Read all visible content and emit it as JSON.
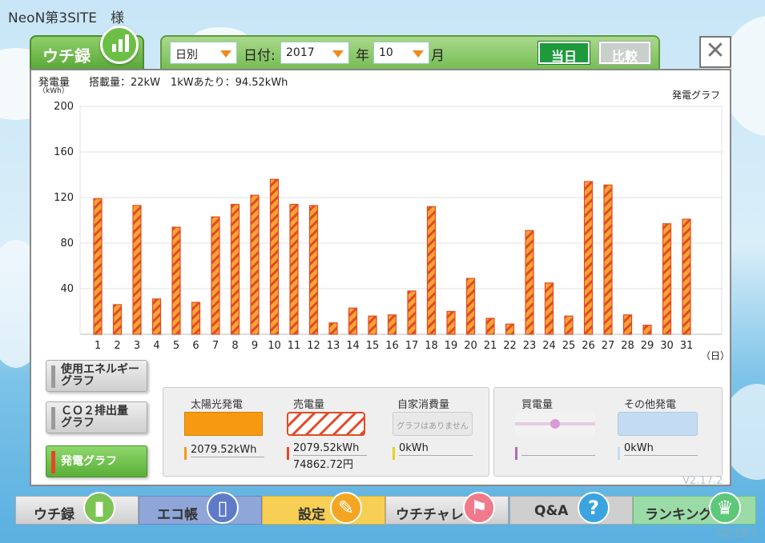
{
  "site": {
    "title": "NeoN第3SITE　様"
  },
  "tab": {
    "label": "ウチ録",
    "icon": "bar-chart-icon"
  },
  "topbar": {
    "mode": "日別",
    "date_label": "日付:",
    "year": "2017",
    "year_unit": "年",
    "month": "10",
    "month_unit": "月",
    "today_label": "当日",
    "compare_label": "比較"
  },
  "panel": {
    "title": "発電量",
    "unit": "（kWh）",
    "capacity": "搭載量：22kW　1kWあたり：94.52kWh",
    "graph_name": "発電グラフ",
    "x_unit": "（日）"
  },
  "chart_data": {
    "type": "bar",
    "categories": [
      "1",
      "2",
      "3",
      "4",
      "5",
      "6",
      "7",
      "8",
      "9",
      "10",
      "11",
      "12",
      "13",
      "14",
      "15",
      "16",
      "17",
      "18",
      "19",
      "20",
      "21",
      "22",
      "23",
      "24",
      "25",
      "26",
      "27",
      "28",
      "29",
      "30",
      "31"
    ],
    "values": [
      119,
      26,
      113,
      31,
      94,
      28,
      103,
      114,
      122,
      136,
      114,
      113,
      10,
      23,
      16,
      17,
      38,
      112,
      20,
      49,
      14,
      9,
      91,
      45,
      16,
      134,
      131,
      17,
      8,
      97,
      101
    ],
    "ylim": [
      0,
      200
    ],
    "yticks": [
      "40",
      "80",
      "120",
      "160",
      "200"
    ],
    "ytick_values": [
      40,
      80,
      120,
      160,
      200
    ],
    "colors": {
      "fill": "#f7a534",
      "stripe": "#e24a26"
    }
  },
  "sidebar": {
    "energy": "使用エネルギー\nグラフ",
    "co2": "ＣＯ２排出量\nグラフ",
    "power": "発電グラフ"
  },
  "legend": {
    "solar": {
      "title": "太陽光発電",
      "value": "2079.52kWh"
    },
    "sell": {
      "title": "売電量",
      "value": "2079.52kWh",
      "yen": "74862.72円"
    },
    "self": {
      "title": "自家消費量",
      "note": "グラフはありません",
      "value": "0kWh"
    },
    "buy": {
      "title": "買電量"
    },
    "other": {
      "title": "その他発電",
      "value": "0kWh"
    }
  },
  "nav": {
    "uchiroku": "ウチ録",
    "ecocho": "エコ帳",
    "settei": "設定",
    "uchichare": "ウチチャレ",
    "qa": "Q&A",
    "ranking": "ランキング"
  },
  "version": {
    "bottom": "V2.19.1",
    "ghost": "V2.17.2"
  }
}
